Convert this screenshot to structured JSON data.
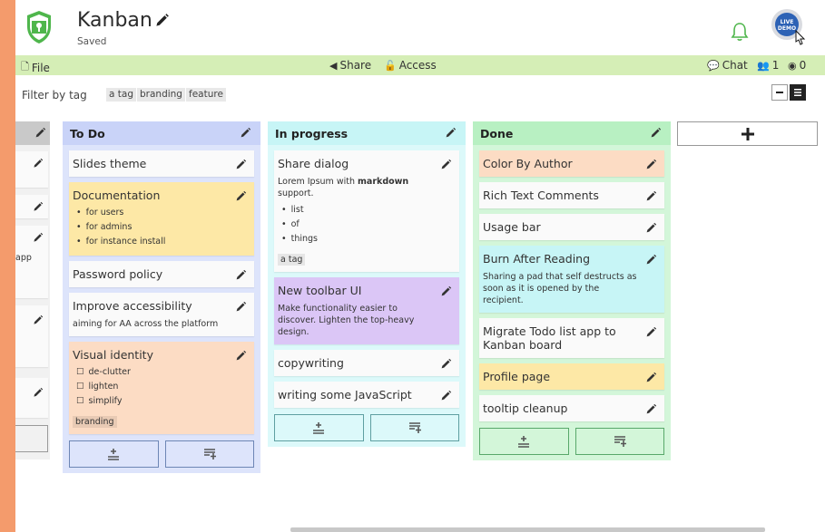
{
  "header": {
    "title": "Kanban",
    "status": "Saved",
    "demo_label": "LIVE DEMO"
  },
  "toolbar": {
    "file": "File",
    "share": "Share",
    "access": "Access",
    "chat": "Chat",
    "users_count": "1",
    "viewers_count": "0"
  },
  "filter": {
    "label": "Filter by tag",
    "tags": [
      "a tag",
      "branding",
      "feature"
    ]
  },
  "partial_column": {
    "visible_text": "app"
  },
  "columns": [
    {
      "title": "To Do",
      "color": "#c9d3f8",
      "body_color": "#dde4fb",
      "cards": [
        {
          "title": "Slides theme",
          "color": "#fafafa"
        },
        {
          "title": "Documentation",
          "color": "#fde8a6",
          "list": [
            "for users",
            "for admins",
            "for instance install"
          ]
        },
        {
          "title": "Password policy",
          "color": "#fafafa"
        },
        {
          "title": "Improve accessibility",
          "color": "#fafafa",
          "desc": "aiming for AA across the platform"
        },
        {
          "title": "Visual identity",
          "color": "#fcdcc4",
          "checklist": [
            "de-clutter",
            "lighten",
            "simplify"
          ],
          "tag": "branding"
        }
      ]
    },
    {
      "title": "In progress",
      "color": "#c7f5f6",
      "body_color": "#dcf9fa",
      "cards": [
        {
          "title": "Share dialog",
          "color": "#fafafa",
          "desc_pre": "Lorem Ipsum with ",
          "desc_bold": "markdown",
          "desc_post": " support.",
          "list": [
            "list",
            "of",
            "things"
          ],
          "tag": "a tag"
        },
        {
          "title": "New toolbar UI",
          "color": "#dbc6f6",
          "desc": "Make functionality easier to discover. Lighten the top-heavy design."
        },
        {
          "title": "copywriting",
          "color": "#fafafa"
        },
        {
          "title": "writing some JavaScript",
          "color": "#fafafa"
        }
      ]
    },
    {
      "title": "Done",
      "color": "#b8f0c2",
      "body_color": "#d3f6d9",
      "cards": [
        {
          "title": "Color By Author",
          "color": "#fcdcc4"
        },
        {
          "title": "Rich Text Comments",
          "color": "#fafafa"
        },
        {
          "title": "Usage bar",
          "color": "#fafafa"
        },
        {
          "title": "Burn After Reading",
          "color": "#c7f5f6",
          "desc": "Sharing a pad that self destructs as soon as it is opened by the recipient."
        },
        {
          "title": "Migrate Todo list app to Kanban board",
          "color": "#fafafa"
        },
        {
          "title": "Profile page",
          "color": "#fde8a6"
        },
        {
          "title": "tooltip cleanup",
          "color": "#fafafa"
        }
      ]
    }
  ],
  "icons": {
    "edit": "pencil-icon",
    "add_card_top": "add-to-top-icon",
    "add_card_bottom": "add-to-bottom-icon",
    "new_column": "plus-icon"
  }
}
